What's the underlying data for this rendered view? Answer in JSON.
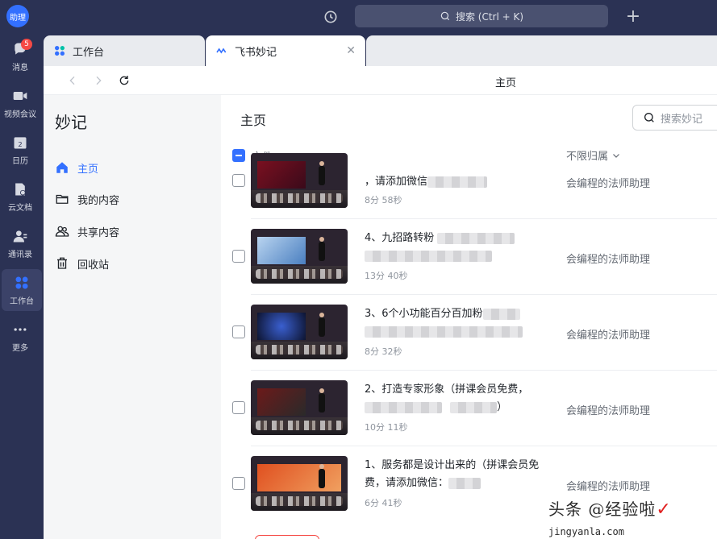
{
  "top": {
    "avatar_text": "助理",
    "search_placeholder": "搜索 (Ctrl + K)"
  },
  "leftnav": [
    {
      "label": "消息",
      "icon": "message-icon",
      "badge": "5"
    },
    {
      "label": "视频会议",
      "icon": "video-icon"
    },
    {
      "label": "日历",
      "icon": "calendar-icon",
      "day": "2"
    },
    {
      "label": "云文档",
      "icon": "docs-icon"
    },
    {
      "label": "通讯录",
      "icon": "contacts-icon"
    },
    {
      "label": "工作台",
      "icon": "workplace-icon",
      "active": true
    },
    {
      "label": "更多",
      "icon": "more-icon"
    }
  ],
  "tabs": [
    {
      "label": "工作台"
    },
    {
      "label": "飞书妙记"
    }
  ],
  "toolbar": {
    "page_title": "主页"
  },
  "sidebar": {
    "app_title": "妙记",
    "items": [
      {
        "label": "主页",
        "active": true
      },
      {
        "label": "我的内容"
      },
      {
        "label": "共享内容"
      },
      {
        "label": "回收站"
      }
    ]
  },
  "main": {
    "title": "主页",
    "search_placeholder": "搜索妙记",
    "col_file": "文件",
    "owner_filter": "不限归属",
    "rows": [
      {
        "title": "，请添加微信",
        "duration": "8分 58秒",
        "owner": "会编程的法师助理"
      },
      {
        "title": "4、九招路转粉",
        "duration": "13分 40秒",
        "owner": "会编程的法师助理"
      },
      {
        "title": "3、6个小功能百分百加粉",
        "duration": "8分 32秒",
        "owner": "会编程的法师助理"
      },
      {
        "title": "2、打造专家形象（拼课会员免费，",
        "title_end": "）",
        "duration": "10分 11秒",
        "owner": "会编程的法师助理"
      },
      {
        "title": "1、服务都是设计出来的（拼课会员免费，请添加微信：",
        "duration": "6分 41秒",
        "owner": "会编程的法师助理"
      }
    ]
  },
  "watermark": {
    "text": "头条 @经验啦",
    "url": "jingyanla.com"
  },
  "colors": {
    "accent": "#3370ff",
    "nav_bg": "#2b3254",
    "badge": "#f54a45"
  }
}
